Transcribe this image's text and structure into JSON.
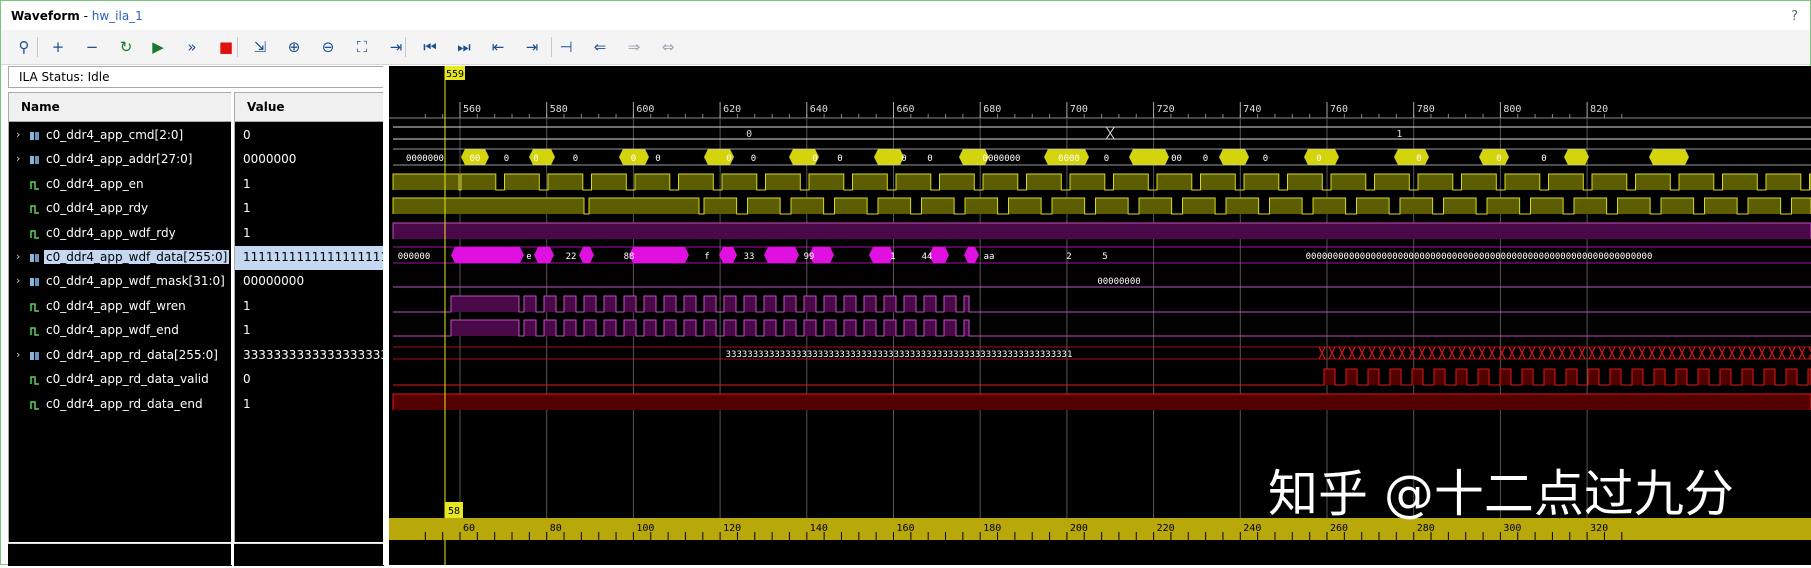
{
  "window": {
    "title": "Waveform",
    "separator": " - ",
    "subtitle": "hw_ila_1",
    "help": "?"
  },
  "toolbar": {
    "buttons": [
      {
        "icon": "search-icon",
        "glyph": "⚲"
      },
      {
        "icon": "plus-icon",
        "glyph": "+"
      },
      {
        "icon": "minus-icon",
        "glyph": "−"
      },
      {
        "icon": "refresh-icon",
        "glyph": "↻"
      },
      {
        "icon": "play-icon",
        "glyph": "▶"
      },
      {
        "icon": "fast-forward-icon",
        "glyph": "»"
      },
      {
        "icon": "stop-icon",
        "glyph": "■"
      },
      {
        "icon": "export-icon",
        "glyph": "⇲"
      },
      {
        "icon": "zoom-in-icon",
        "glyph": "⊕"
      },
      {
        "icon": "zoom-out-icon",
        "glyph": "⊖"
      },
      {
        "icon": "zoom-fit-icon",
        "glyph": "⛶"
      },
      {
        "icon": "go-to-cursor-icon",
        "glyph": "⇥"
      },
      {
        "icon": "go-to-start-icon",
        "glyph": "⏮"
      },
      {
        "icon": "go-to-end-icon",
        "glyph": "⏭"
      },
      {
        "icon": "previous-transition-icon",
        "glyph": "⇤"
      },
      {
        "icon": "next-transition-icon",
        "glyph": "⇥"
      },
      {
        "icon": "add-marker-icon",
        "glyph": "⊣"
      },
      {
        "icon": "previous-marker-icon",
        "glyph": "⇐"
      },
      {
        "icon": "next-marker-icon",
        "glyph": "⇒"
      },
      {
        "icon": "swap-cursors-icon",
        "glyph": "⇔"
      }
    ],
    "colors": {
      "stop": "#e01010",
      "default": "#1b4f8f",
      "disabled": "#9aa5b3"
    }
  },
  "ila_status": "ILA Status:  Idle",
  "columns": {
    "name": "Name",
    "value": "Value"
  },
  "signals": [
    {
      "name": "c0_ddr4_app_cmd[2:0]",
      "value": "0",
      "bus": true
    },
    {
      "name": "c0_ddr4_app_addr[27:0]",
      "value": "0000000",
      "bus": true
    },
    {
      "name": "c0_ddr4_app_en",
      "value": "1",
      "bus": false
    },
    {
      "name": "c0_ddr4_app_rdy",
      "value": "1",
      "bus": false
    },
    {
      "name": "c0_ddr4_app_wdf_rdy",
      "value": "1",
      "bus": false
    },
    {
      "name": "c0_ddr4_app_wdf_data[255:0]",
      "value": "1111111111111111111111",
      "bus": true,
      "selected": true
    },
    {
      "name": "c0_ddr4_app_wdf_mask[31:0]",
      "value": "00000000",
      "bus": true
    },
    {
      "name": "c0_ddr4_app_wdf_wren",
      "value": "1",
      "bus": false
    },
    {
      "name": "c0_ddr4_app_wdf_end",
      "value": "1",
      "bus": false
    },
    {
      "name": "c0_ddr4_app_rd_data[255:0]",
      "value": "333333333333333333333333",
      "bus": true
    },
    {
      "name": "c0_ddr4_app_rd_data_valid",
      "value": "0",
      "bus": false
    },
    {
      "name": "c0_ddr4_app_rd_data_end",
      "value": "1",
      "bus": false
    }
  ],
  "waveform": {
    "cursor_top_label": "559",
    "cursor_bottom_label": "58",
    "top_ruler_labels": [
      "560",
      "580",
      "600",
      "620",
      "640",
      "660",
      "680",
      "700",
      "720",
      "740",
      "760",
      "780",
      "800",
      "820"
    ],
    "bottom_ruler_labels": [
      "60",
      "80",
      "100",
      "120",
      "140",
      "160",
      "180",
      "200",
      "220",
      "240",
      "260",
      "280",
      "300",
      "320"
    ],
    "cmd_values": [
      "0",
      "1"
    ],
    "addr_values": [
      "0000000",
      "00",
      "0",
      "0",
      "0",
      "0",
      "0",
      "0",
      "0",
      "0",
      "0",
      "0",
      "0",
      "0000000",
      "0000",
      "0",
      "00",
      "0",
      "0",
      "0",
      "0",
      "0",
      "0"
    ],
    "wdf_data_values": [
      "000000",
      "e",
      "22",
      "88",
      "f",
      "33",
      "99",
      "1",
      "44",
      "aa",
      "2",
      "5"
    ],
    "wdf_data_tail": "0000000000000000000000000000000000000000000000000000000000000000",
    "wdf_mask_value": "00000000",
    "rd_data_value": "3333333333333333333333333333333333333333333333333333333333333331",
    "colors": {
      "bus_addr": "#d4d40c",
      "bit_olive": "#5c5c00",
      "olive_line": "#d8d820",
      "magenta": "#e010e0",
      "purple_fill": "#4a0a4a",
      "purple_line": "#c050c0",
      "red": "#e01818",
      "red_fill": "#520000",
      "cursor": "#e8e820",
      "ruler_bottom": "#b8a80a",
      "grid": "#555555"
    }
  },
  "watermark": "知乎 @十二点过九分"
}
